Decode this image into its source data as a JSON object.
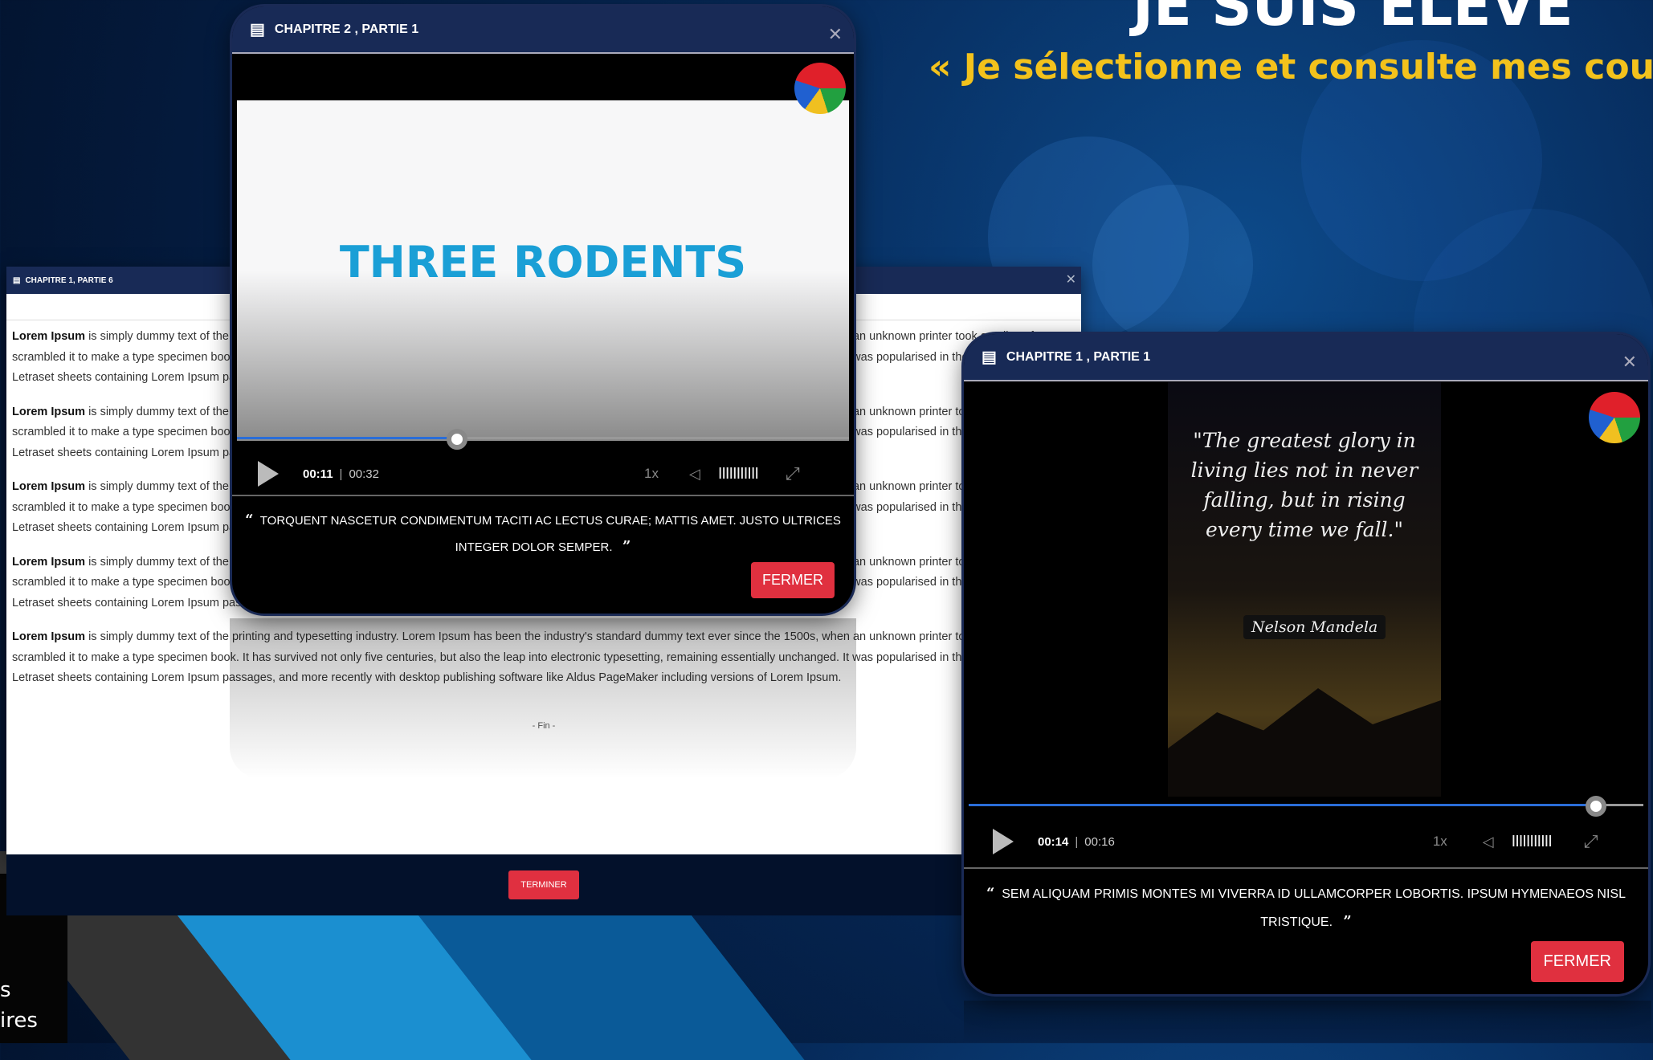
{
  "background": {
    "headline": "JE SUIS ÉLÈVE",
    "subheadline": "« Je sélectionne et consulte mes cours",
    "corner_line1": "s",
    "corner_line2": "ires"
  },
  "doc_window": {
    "title": "CHAPITRE 1, PARTIE 6",
    "paragraphs": [
      {
        "lead": "Lorem Ipsum",
        "text": " is simply dummy text of the printing and typesetting industry. Lorem Ipsum has been the industry's standard dummy text ever since the 1500s, when an unknown printer took a galley of type and",
        "line2": "scrambled it to make a type specimen book. It has survived not only five centuries, but also the leap into electronic typesetting, remaining essentially unchanged. It was popularised in the 1960s with the release of",
        "line3": "Letraset sheets containing Lorem Ipsum passages, and more recently with desktop publishing software like Aldus PageMaker including versions of Lorem Ipsum."
      },
      {
        "lead": "Lorem Ipsum",
        "text": " is simply dummy text of the printing and typesetting industry. Lorem Ipsum has been the industry's standard dummy text ever since the 1500s, when an unknown printer took a galley of type and",
        "line2": "scrambled it to make a type specimen book. It has survived not only five centuries, but also the leap into electronic typesetting, remaining essentially unchanged. It was popularised in the 1960s with the release of",
        "line3": "Letraset sheets containing Lorem Ipsum passages, and more recently with desktop publishing software like Aldus PageMaker including versions of Lorem Ipsum."
      },
      {
        "lead": "Lorem Ipsum",
        "text": " is simply dummy text of the printing and typesetting industry. Lorem Ipsum has been the industry's standard dummy text ever since the 1500s, when an unknown printer took a galley of type and",
        "line2": "scrambled it to make a type specimen book. It has survived not only five centuries, but also the leap into electronic typesetting, remaining essentially unchanged. It was popularised in the 1960s with the release of",
        "line3": "Letraset sheets containing Lorem Ipsum passages, and more recently with desktop publishing software like Aldus PageMaker including versions of Lorem Ipsum."
      },
      {
        "lead": "Lorem Ipsum",
        "text": " is simply dummy text of the printing and typesetting industry. Lorem Ipsum has been the industry's standard dummy text ever since the 1500s, when an unknown printer took a galley of type and",
        "line2": "scrambled it to make a type specimen book. It has survived not only five centuries, but also the leap into electronic typesetting, remaining essentially unchanged. It was popularised in the 1960s with the release of",
        "line3": "Letraset sheets containing Lorem Ipsum passages, and more recently with desktop publishing software like Aldus PageMaker including versions of Lorem Ipsum."
      },
      {
        "lead": "Lorem Ipsum",
        "text": " is simply dummy text of the printing and typesetting industry. Lorem Ipsum has been the industry's standard dummy text ever since the 1500s, when an unknown printer took a galley of type and",
        "line2": "scrambled it to make a type specimen book. It has survived not only five centuries, but also the leap into electronic typesetting, remaining essentially unchanged. It was popularised in the 1960s with the release of",
        "line3": "Letraset sheets containing Lorem Ipsum passages, and more recently with desktop publishing software like Aldus PageMaker including versions of Lorem Ipsum."
      }
    ],
    "fin": "- Fin -",
    "terminer": "TERMINER"
  },
  "video1": {
    "title": "CHAPITRE 2 , PARTIE 1",
    "slide_text": "THREE RODENTS",
    "current": "00:11",
    "duration": "00:32",
    "progress_fraction": 0.36,
    "speed": "1x",
    "volume_bars": "IIIIIIIIIII",
    "caption_line1": "TORQUENT NASCETUR CONDIMENTUM TACITI AC LECTUS CURAE; MATTIS AMET. JUSTO ULTRICES",
    "caption_line2": "INTEGER DOLOR SEMPER.",
    "fermer": "FERMER"
  },
  "video2": {
    "title": "CHAPITRE 1 , PARTIE 1",
    "quote_line1": "\"The greatest glory in",
    "quote_line2": "living lies not in never",
    "quote_line3": "falling, but in rising",
    "quote_line4": "every time we fall.\"",
    "author": "Nelson Mandela",
    "current": "00:14",
    "duration": "00:16",
    "progress_fraction": 0.93,
    "speed": "1x",
    "volume_bars": "IIIIIIIIIII",
    "caption_line1": "SEM ALIQUAM PRIMIS MONTES MI VIVERRA ID ULLAMCORPER LOBORTIS. IPSUM HYMENAEOS NISL",
    "caption_line2": "TRISTIQUE.",
    "fermer": "FERMER"
  },
  "colors": {
    "accent_gold": "#f3c21c",
    "window_title_bg": "#182a56",
    "button_red": "#e0303f",
    "progress_blue": "#2a6dd8",
    "slide_text": "#1a9fd6"
  }
}
